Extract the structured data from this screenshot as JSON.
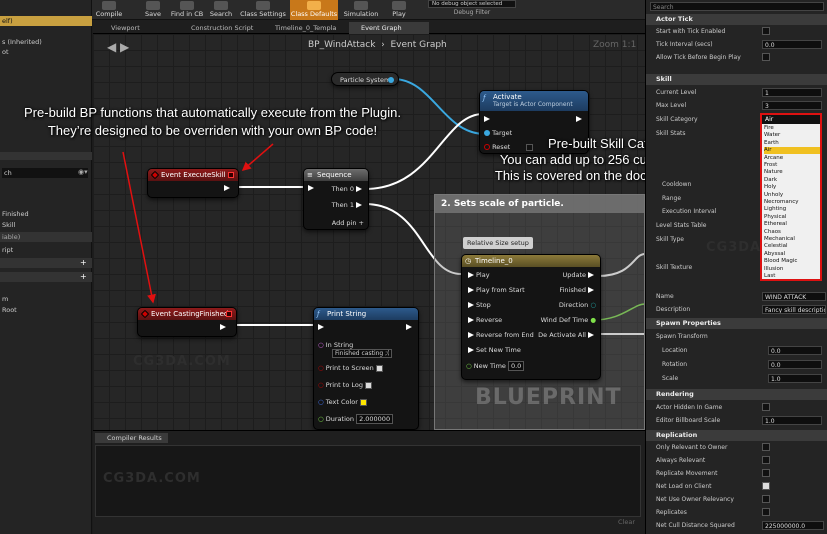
{
  "toolbar": {
    "buttons": [
      "Compile",
      "Save",
      "Find in CB",
      "Search",
      "Class Settings",
      "Class Defaults",
      "Simulation",
      "Play"
    ],
    "debug_select": "No debug object selected",
    "debug_filter": "Debug Filter"
  },
  "left_panel": {
    "rows": [
      "elf)",
      "s (Inherited)",
      "ot",
      "",
      "ch",
      "Finished",
      "Skill",
      "iable)",
      "ript",
      "m",
      "Root"
    ]
  },
  "tabs": [
    "Viewport",
    "Construction Script",
    "Timeline_0_Templa",
    "Event Graph"
  ],
  "graph": {
    "breadcrumb": "BP_WindAttack",
    "section": "Event Graph",
    "zoom": "Zoom 1:1",
    "nodes": {
      "particle": "Particle System",
      "activate": {
        "title": "Activate",
        "subtitle": "Target is Actor Component",
        "target": "Target",
        "reset": "Reset"
      },
      "exec_skill": "Event ExecuteSkill",
      "sequence": {
        "title": "Sequence",
        "then0": "Then 0",
        "then1": "Then 1",
        "add": "Add pin"
      },
      "casting_finished": "Event CastingFinished",
      "print": {
        "title": "Print String",
        "in_string": "In String",
        "in_string_val": "Finished casting ;(",
        "screen": "Print to Screen",
        "log": "Print to Log",
        "color": "Text Color",
        "duration": "Duration",
        "duration_val": "2.000000"
      },
      "comment": "2. Sets scale of particle.",
      "relative": "Relative Size setup",
      "timeline": {
        "title": "Timeline_0",
        "pins_in": [
          "Play",
          "Play from Start",
          "Stop",
          "Reverse",
          "Reverse from End",
          "Set New Time",
          "New Time"
        ],
        "new_time_val": "0.0",
        "pins_out": [
          "Update",
          "Finished",
          "Direction",
          "Wind Def Time",
          "De Activate All"
        ]
      }
    },
    "blueprint_watermark": "BLUEPRINT"
  },
  "annotations": {
    "a1_line1": "Pre-build BP functions that automatically execute from the Plugin.",
    "a1_line2": "They’re designed to be overriden with your own BP code!",
    "a2_line1": "Pre-built Skill Categories.",
    "a2_line2": "You can add up to 256 custom categories!",
    "a2_line3": "This is covered on the documentation page!"
  },
  "compiler": {
    "title": "Compiler Results",
    "clear": "Clear"
  },
  "details": {
    "search": "Search",
    "actor_tick": {
      "head": "Actor Tick",
      "start": "Start with Tick Enabled",
      "interval": "Tick Interval (secs)",
      "interval_val": "0.0",
      "allow": "Allow Tick Before Begin Play"
    },
    "skill": {
      "head": "Skill",
      "current": "Current Level",
      "current_val": "1",
      "max": "Max Level",
      "max_val": "3",
      "category": "Skill Category",
      "category_val": "Air",
      "stats": "Skill Stats",
      "cooldown": "Cooldown",
      "range": "Range",
      "exec_interval": "Execution Interval",
      "level_table": "Level Stats Table",
      "type": "Skill Type",
      "texture": "Skill Texture",
      "name": "Name",
      "name_val": "WIND ATTACK",
      "desc": "Description",
      "desc_val": "Fancy skill description"
    },
    "categories": [
      "Fire",
      "Water",
      "Earth",
      "Air",
      "Arcane",
      "Frost",
      "Nature",
      "Dark",
      "Holy",
      "Unholy",
      "Necromancy",
      "Lighting",
      "Physical",
      "Ethereal",
      "Chaos",
      "Mechanical",
      "Celestial",
      "Abyssal",
      "Blood Magic",
      "Illusion",
      "Last"
    ],
    "spawn": {
      "head": "Spawn Properties",
      "transform": "Spawn Transform",
      "location": "Location",
      "loc_val": "0.0",
      "rotation": "Rotation",
      "rot_val": "0.0",
      "scale": "Scale",
      "scale_val": "1.0"
    },
    "rendering": {
      "head": "Rendering",
      "hidden": "Actor Hidden In Game",
      "billboard": "Editor Billboard Scale",
      "billboard_val": "1.0"
    },
    "replication": {
      "head": "Replication",
      "owner": "Only Relevant to Owner",
      "always": "Always Relevant",
      "movement": "Replicate Movement",
      "net_load": "Net Load on Client",
      "net_use": "Net Use Owner Relevancy",
      "replicates": "Replicates",
      "cull": "Net Cull Distance Squared",
      "cull_val": "225000000.0"
    }
  },
  "watermarks": [
    "CG3DA.COM",
    "CG3DA.COM",
    "CG3DA.COM"
  ]
}
